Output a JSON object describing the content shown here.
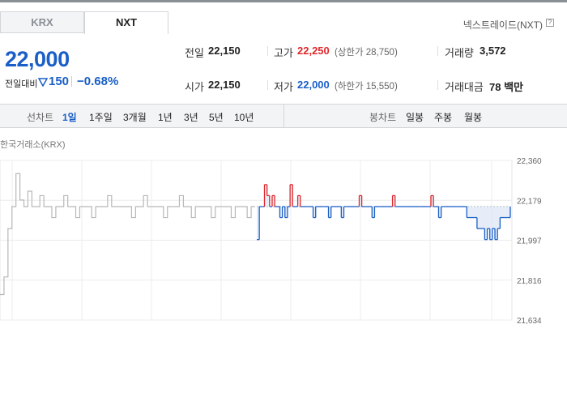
{
  "tabs": [
    {
      "label": "KRX"
    },
    {
      "label": "NXT"
    }
  ],
  "exchange_label": "넥스트레이드(NXT)",
  "help_icon_text": "?",
  "price": "22,000",
  "change": {
    "label": "전일대비",
    "value": "150",
    "rate": "−0.68%",
    "direction": "down"
  },
  "stats": {
    "prev_close_label": "전일",
    "prev_close": "22,150",
    "open_label": "시가",
    "open": "22,150",
    "high_label": "고가",
    "high": "22,250",
    "upper_limit": "(상한가 28,750)",
    "low_label": "저가",
    "low": "22,000",
    "lower_limit": "(하한가 15,550)",
    "volume_label": "거래량",
    "volume": "3,572",
    "amount_label": "거래대금",
    "amount": "78 백만"
  },
  "toolbar": {
    "line_label": "선차트",
    "periods": [
      "1일",
      "1주일",
      "3개월",
      "1년",
      "3년",
      "5년",
      "10년"
    ],
    "active_period": "1일",
    "candle_label": "봉차트",
    "candles": [
      "일봉",
      "주봉",
      "월봉"
    ]
  },
  "chart_source_label": "한국거래소(KRX)",
  "colors": {
    "up": "#e0282b",
    "down": "#1a5fc7",
    "price": "#1a5fc7",
    "krx_line": "#b8b8b8"
  },
  "chart_data": {
    "type": "line",
    "ylim": [
      21634,
      22360
    ],
    "y_ticks": [
      "22,360",
      "22,179",
      "21,997",
      "21,816",
      "21,634"
    ],
    "base_price": 22150,
    "krx_series": [
      21750,
      21830,
      22050,
      22150,
      22300,
      22180,
      22150,
      22220,
      22150,
      22150,
      22200,
      22150,
      22150,
      22100,
      22150,
      22150,
      22200,
      22150,
      22150,
      22100,
      22150,
      22150,
      22150,
      22100,
      22150,
      22150,
      22150,
      22200,
      22150,
      22150,
      22150,
      22150,
      22150,
      22100,
      22150,
      22150,
      22200,
      22150,
      22150,
      22150,
      22150,
      22100,
      22150,
      22150,
      22150,
      22200,
      22150,
      22150,
      22100,
      22150,
      22150,
      22150,
      22150,
      22100,
      22150,
      22150,
      22150,
      22150,
      22100,
      22150,
      22150,
      22150,
      22100,
      22150,
      22150
    ],
    "nxt_series": [
      22000,
      22150,
      22150,
      22250,
      22200,
      22150,
      22200,
      22150,
      22150,
      22100,
      22150,
      22100,
      22150,
      22250,
      22150,
      22150,
      22200,
      22150,
      22150,
      22150,
      22150,
      22150,
      22100,
      22150,
      22150,
      22150,
      22150,
      22150,
      22100,
      22150,
      22150,
      22150,
      22150,
      22100,
      22150,
      22150,
      22150,
      22150,
      22150,
      22150,
      22200,
      22150,
      22150,
      22150,
      22150,
      22100,
      22150,
      22150,
      22150,
      22150,
      22150,
      22150,
      22150,
      22200,
      22150,
      22150,
      22150,
      22150,
      22150,
      22150,
      22150,
      22150,
      22150,
      22150,
      22150,
      22150,
      22150,
      22150,
      22200,
      22150,
      22150,
      22100,
      22150,
      22150,
      22150,
      22150,
      22150,
      22150,
      22150,
      22150,
      22150,
      22150,
      22100,
      22100,
      22100,
      22100,
      22050,
      22050,
      22050,
      22000,
      22050,
      22000,
      22050,
      22000,
      22050,
      22100,
      22100,
      22100,
      22100,
      22150
    ]
  }
}
